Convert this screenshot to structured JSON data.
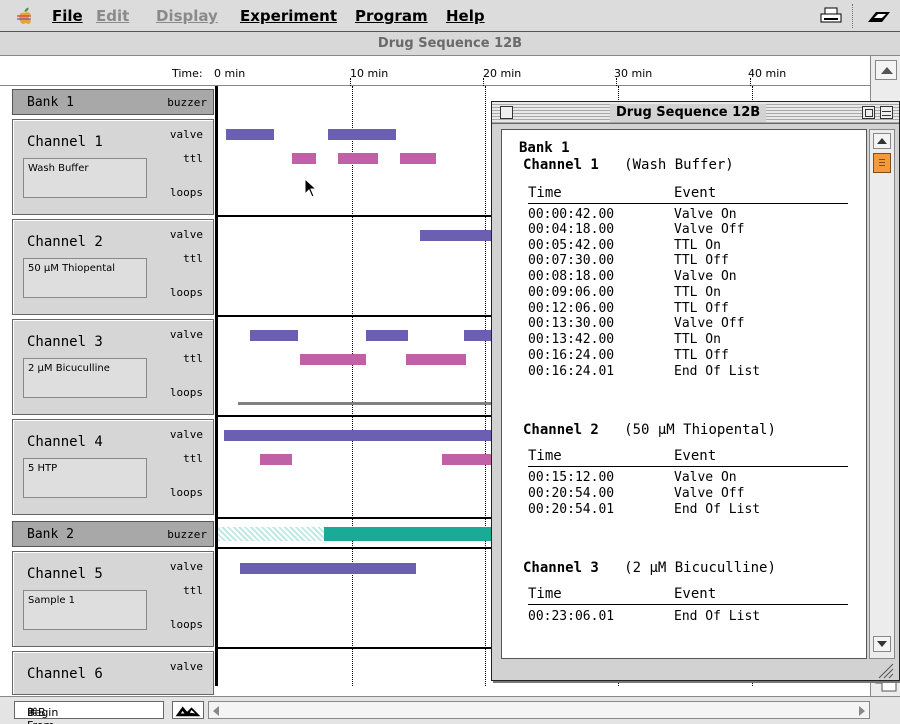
{
  "menubar": {
    "items": [
      {
        "label": "File",
        "state": "enabled"
      },
      {
        "label": "Edit",
        "state": "disabled"
      },
      {
        "label": "Display",
        "state": "disabled"
      },
      {
        "label": "Experiment",
        "state": "enabled"
      },
      {
        "label": "Program",
        "state": "enabled"
      },
      {
        "label": "Help",
        "state": "enabled"
      }
    ],
    "icons": [
      "apple-icon",
      "printer-icon",
      "app-switcher-icon"
    ]
  },
  "window": {
    "title": "Drug Sequence 12B"
  },
  "ruler": {
    "time_label": "Time:",
    "ticks": [
      "0 min",
      "10 min",
      "20 min",
      "30 min",
      "40 min"
    ]
  },
  "banks": [
    {
      "name": "Bank 1",
      "buzzer_label": "buzzer"
    },
    {
      "name": "Bank 2",
      "buzzer_label": "buzzer"
    }
  ],
  "channels": [
    {
      "name": "Channel 1",
      "substance": "Wash Buffer",
      "rows": [
        "valve",
        "ttl",
        "loops"
      ]
    },
    {
      "name": "Channel 2",
      "substance": "50 µM Thiopental",
      "rows": [
        "valve",
        "ttl",
        "loops"
      ]
    },
    {
      "name": "Channel 3",
      "substance": "2 µM Bicuculline",
      "rows": [
        "valve",
        "ttl",
        "loops"
      ]
    },
    {
      "name": "Channel 4",
      "substance": "5 HTP",
      "rows": [
        "valve",
        "ttl",
        "loops"
      ]
    },
    {
      "name": "Channel 5",
      "substance": "Sample 1",
      "rows": [
        "valve",
        "ttl",
        "loops"
      ]
    },
    {
      "name": "Channel 6",
      "substance": "",
      "rows": [
        "valve"
      ]
    }
  ],
  "colors": {
    "valve": "#6a5fb0",
    "ttl": "#c061a8",
    "loops": "#808080",
    "buzzer": "#1aab97",
    "scroll_thumb": "#f29a3c"
  },
  "bottombar": {
    "begin_label": "Begin From…",
    "begin_shortcut": "⌘B",
    "icons": [
      "mountain-icon"
    ]
  },
  "popup": {
    "title": "Drug Sequence 12B",
    "bank": "Bank 1",
    "col_time": "Time",
    "col_event": "Event",
    "sections": [
      {
        "channel": "Channel 1",
        "substance": "(Wash Buffer)",
        "events": [
          {
            "time": "00:00:42.00",
            "event": "Valve On"
          },
          {
            "time": "00:04:18.00",
            "event": "Valve Off"
          },
          {
            "time": "00:05:42.00",
            "event": "TTL On"
          },
          {
            "time": "00:07:30.00",
            "event": "TTL Off"
          },
          {
            "time": "00:08:18.00",
            "event": "Valve On"
          },
          {
            "time": "00:09:06.00",
            "event": "TTL On"
          },
          {
            "time": "00:12:06.00",
            "event": "TTL Off"
          },
          {
            "time": "00:13:30.00",
            "event": "Valve Off"
          },
          {
            "time": "00:13:42.00",
            "event": "TTL On"
          },
          {
            "time": "00:16:24.00",
            "event": "TTL Off"
          },
          {
            "time": "00:16:24.01",
            "event": "End Of List"
          }
        ]
      },
      {
        "channel": "Channel 2",
        "substance": "(50 µM Thiopental)",
        "events": [
          {
            "time": "00:15:12.00",
            "event": "Valve On"
          },
          {
            "time": "00:20:54.00",
            "event": "Valve Off"
          },
          {
            "time": "00:20:54.01",
            "event": "End Of List"
          }
        ]
      },
      {
        "channel": "Channel 3",
        "substance": "(2 µM Bicuculline)",
        "events": [
          {
            "time": "00:23:06.01",
            "event": "End Of List"
          }
        ]
      }
    ]
  }
}
